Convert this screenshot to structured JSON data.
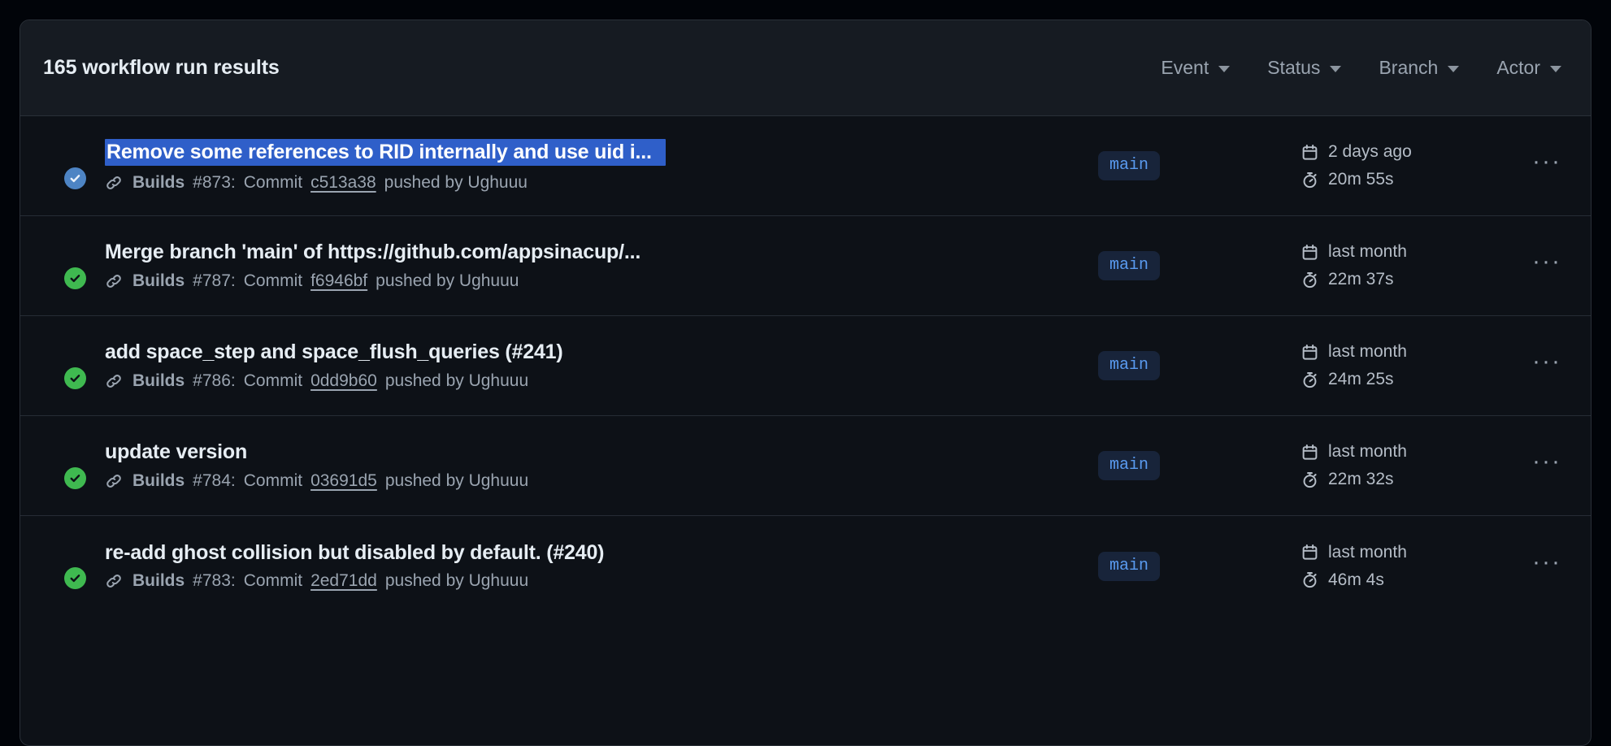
{
  "header": {
    "results_count": "165 workflow run results",
    "filters": [
      {
        "label": "Event",
        "icon": "chevron-down-icon"
      },
      {
        "label": "Status",
        "icon": "chevron-down-icon"
      },
      {
        "label": "Branch",
        "icon": "chevron-down-icon"
      },
      {
        "label": "Actor",
        "icon": "chevron-down-icon"
      }
    ]
  },
  "colors": {
    "success_green": "#3fb950",
    "selection_blue": "#2f5fc9",
    "branch_blue": "#5a9bf0",
    "card_bg": "#0d1117",
    "header_bg": "#161b22"
  },
  "overflow_label": "···",
  "runs": [
    {
      "status": "success",
      "title": "Remove some references to RID internally and use uid i...",
      "selected": true,
      "workflow": "Builds",
      "run_number": "#873:",
      "commit_word": "Commit",
      "sha": "c513a38",
      "pushed_by": "pushed by Ughuuu",
      "branch": "main",
      "time_ago": "2 days ago",
      "duration": "20m 55s"
    },
    {
      "status": "success",
      "title": "Merge branch 'main' of https://github.com/appsinacup/...",
      "selected": false,
      "workflow": "Builds",
      "run_number": "#787:",
      "commit_word": "Commit",
      "sha": "f6946bf",
      "pushed_by": "pushed by Ughuuu",
      "branch": "main",
      "time_ago": "last month",
      "duration": "22m 37s"
    },
    {
      "status": "success",
      "title": "add space_step and space_flush_queries (#241)",
      "selected": false,
      "workflow": "Builds",
      "run_number": "#786:",
      "commit_word": "Commit",
      "sha": "0dd9b60",
      "pushed_by": "pushed by Ughuuu",
      "branch": "main",
      "time_ago": "last month",
      "duration": "24m 25s"
    },
    {
      "status": "success",
      "title": "update version",
      "selected": false,
      "workflow": "Builds",
      "run_number": "#784:",
      "commit_word": "Commit",
      "sha": "03691d5",
      "pushed_by": "pushed by Ughuuu",
      "branch": "main",
      "time_ago": "last month",
      "duration": "22m 32s"
    },
    {
      "status": "success",
      "title": "re-add ghost collision but disabled by default. (#240)",
      "selected": false,
      "workflow": "Builds",
      "run_number": "#783:",
      "commit_word": "Commit",
      "sha": "2ed71dd",
      "pushed_by": "pushed by Ughuuu",
      "branch": "main",
      "time_ago": "last month",
      "duration": "46m 4s"
    }
  ]
}
